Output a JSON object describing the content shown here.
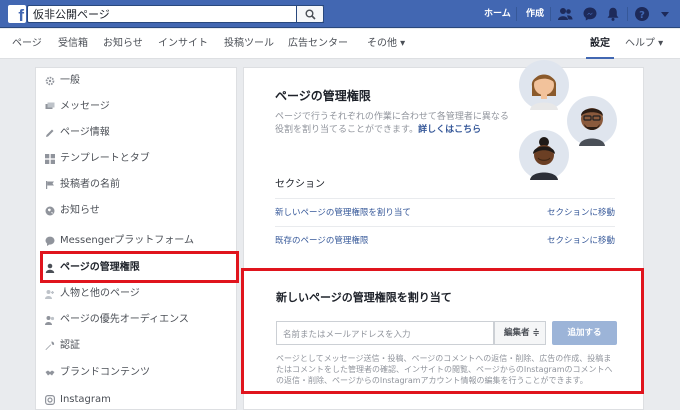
{
  "topbar": {
    "search_value": "仮非公開ページ",
    "links": [
      "ホーム",
      "作成"
    ],
    "icons": [
      "friends-icon",
      "messenger-icon",
      "notifications-icon",
      "help-icon",
      "dropdown-icon"
    ]
  },
  "nav": {
    "items": [
      "ページ",
      "受信箱",
      "お知らせ",
      "インサイト",
      "投稿ツール",
      "広告センター",
      "その他 ▾"
    ],
    "settings": "設定",
    "help": "ヘルプ ▾"
  },
  "sidebar": {
    "items": [
      {
        "label": "一般",
        "icon": "gear-icon"
      },
      {
        "label": "メッセージ",
        "icon": "messages-icon"
      },
      {
        "label": "ページ情報",
        "icon": "pencil-icon"
      },
      {
        "label": "テンプレートとタブ",
        "icon": "grid-icon"
      },
      {
        "label": "投稿者の名前",
        "icon": "flag-icon"
      },
      {
        "label": "お知らせ",
        "icon": "globe-icon"
      },
      {
        "label": "Messengerプラットフォーム",
        "icon": "messenger-icon"
      },
      {
        "label": "ページの管理権限",
        "icon": "person-icon"
      },
      {
        "label": "人物と他のページ",
        "icon": "people-icon"
      },
      {
        "label": "ページの優先オーディエンス",
        "icon": "people-icon"
      },
      {
        "label": "認証",
        "icon": "wrench-icon"
      },
      {
        "label": "ブランドコンテンツ",
        "icon": "handshake-icon"
      },
      {
        "label": "Instagram",
        "icon": "instagram-icon"
      }
    ]
  },
  "main": {
    "title": "ページの管理権限",
    "desc": "ページで行うそれぞれの作業に合わせて各管理者に異なる役割を割り当てることができます。",
    "learn_more": "詳しくはこちら",
    "section_title": "セクション",
    "sections": [
      {
        "label": "新しいページの管理権限を割り当て",
        "link": "セクションに移動"
      },
      {
        "label": "既存のページの管理権限",
        "link": "セクションに移動"
      }
    ]
  },
  "assign": {
    "title": "新しいページの管理権限を割り当て",
    "placeholder": "名前またはメールアドレスを入力",
    "role": "編集者 ≑",
    "add_button": "追加する",
    "desc": "ページとしてメッセージ送信・投稿、ページのコメントへの返信・削除、広告の作成、投稿またはコメントをした管理者の確認、インサイトの閲覧、ページからのInstagramのコメントへの返信・削除、ページからのInstagramアカウント情報の編集を行うことができます。"
  },
  "colors": {
    "brand": "#4267b2",
    "highlight": "#e0141d",
    "link": "#365899"
  }
}
